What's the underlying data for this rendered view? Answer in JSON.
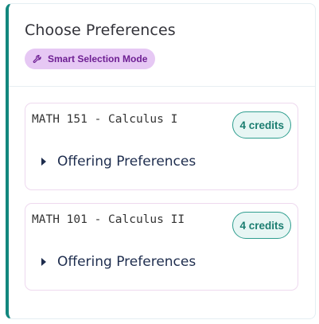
{
  "panel": {
    "title": "Choose Preferences",
    "mode_badge": {
      "label": "Smart Selection Mode",
      "icon": "wrench-icon",
      "bg": "#e6c8f4",
      "fg": "#6e1f93"
    },
    "accent_color": "#12877e"
  },
  "courses": [
    {
      "title": "MATH 151 - Calculus I",
      "credits": "4 credits",
      "section_label": "Offering Preferences",
      "expanded": false
    },
    {
      "title": "MATH 101 - Calculus II",
      "credits": "4 credits",
      "section_label": "Offering Preferences",
      "expanded": false
    }
  ]
}
